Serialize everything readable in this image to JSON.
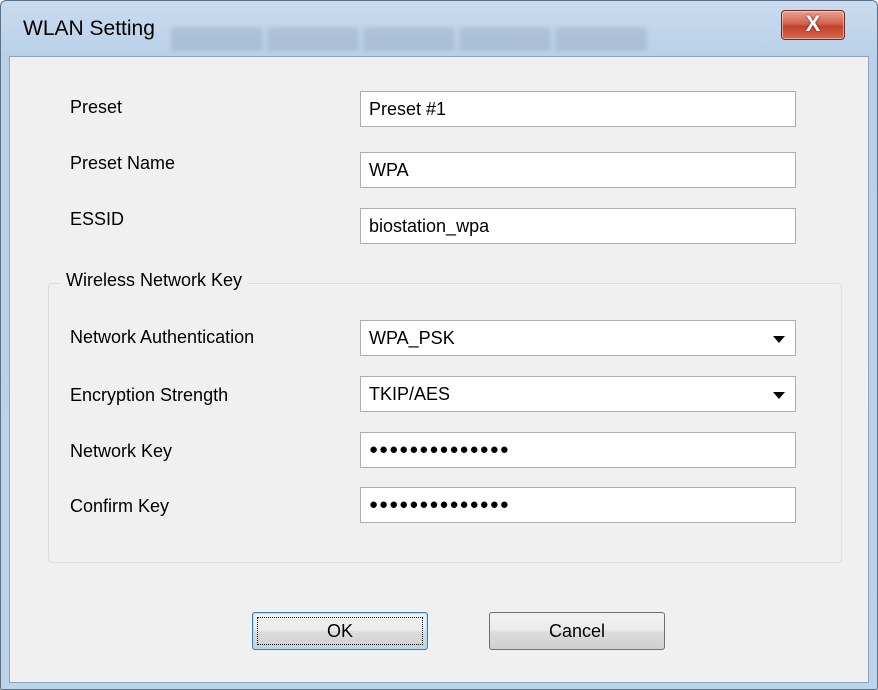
{
  "window": {
    "title": "WLAN Setting",
    "close_glyph": "X"
  },
  "form": {
    "preset": {
      "label": "Preset",
      "value": "Preset #1"
    },
    "preset_name": {
      "label": "Preset Name",
      "value": "WPA"
    },
    "essid": {
      "label": "ESSID",
      "value": "biostation_wpa"
    }
  },
  "wireless_key": {
    "group_title": "Wireless Network Key",
    "authentication": {
      "label": "Network Authentication",
      "value": "WPA_PSK"
    },
    "encryption": {
      "label": "Encryption Strength",
      "value": "TKIP/AES"
    },
    "network_key": {
      "label": "Network Key",
      "masked": "●●●●●●●●●●●●●●"
    },
    "confirm_key": {
      "label": "Confirm Key",
      "masked": "●●●●●●●●●●●●●●"
    }
  },
  "buttons": {
    "ok": "OK",
    "cancel": "Cancel"
  },
  "icons": {
    "close": "close-icon",
    "dropdown": "chevron-down-icon"
  },
  "colors": {
    "close_button": "#c2422c",
    "window_frame": "#bcd3ea",
    "dialog_background": "#f0f0f0"
  }
}
